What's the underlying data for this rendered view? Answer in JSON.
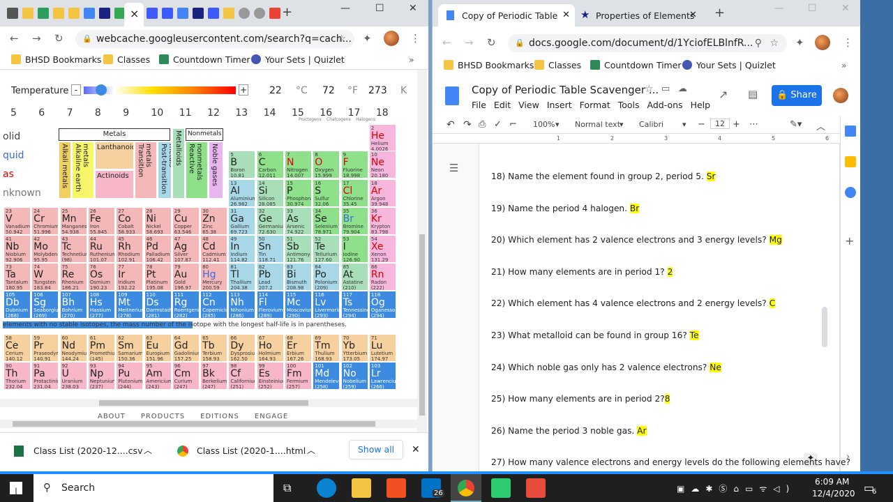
{
  "left": {
    "tabs_close": "×",
    "new_tab": "+",
    "url": "webcache.googleusercontent.com/search?q=cach...",
    "bookmarks": [
      {
        "label": "BHSD Bookmarks",
        "color": "#f4c542"
      },
      {
        "label": "Classes",
        "color": "#f4c542"
      },
      {
        "label": "Countdown Timer",
        "color": "#2e8b57"
      },
      {
        "label": "Your Sets | Quizlet",
        "color": "#4257b2"
      }
    ],
    "temperature": {
      "label": "Temperature",
      "minus": "-",
      "plus": "+",
      "celsius": "22",
      "c_unit": "°C",
      "fahrenheit": "72",
      "f_unit": "°F",
      "kelvin": "273",
      "k_unit": "K",
      "slider_fraction": 0.06
    },
    "group_numbers": [
      "5",
      "6",
      "7",
      "8",
      "9",
      "10",
      "11",
      "12",
      "13",
      "14",
      "15",
      "16",
      "17",
      "18"
    ],
    "group_subs": {
      "g15": "Pnictogens",
      "g16": "Chalcogens",
      "g17": "Halogens"
    },
    "states": [
      "olid",
      "quid",
      "as",
      "nknown"
    ],
    "categories": {
      "metals": "Metals",
      "nonmetals": "Nonmetals",
      "metalloids": "Metalloids",
      "alkali": "Alkali metals",
      "alkaline": "Alkaline earth metals",
      "lanthanoids": "Lanthanoids",
      "actinoids": "Actinoids",
      "transition": "Transition metals",
      "post_transition": "Post-transition metals",
      "reactive": "Reactive nonmetals",
      "noble": "Noble gases"
    },
    "note": "elements with no stable isotopes, the mass number of the isotope with the longest half-life is in parentheses.",
    "footer_links": [
      "ABOUT",
      "PRODUCTS",
      "EDITIONS",
      "ENGAGE"
    ]
  },
  "elements": [
    {
      "n": "2",
      "s": "He",
      "nm": "Helium",
      "m": "4.0026",
      "c": "#f7b7dc",
      "col": 18,
      "row": 1
    },
    {
      "n": "5",
      "s": "B",
      "nm": "Boron",
      "m": "10.81",
      "c": "#a8dfb8",
      "col": 13,
      "row": 2
    },
    {
      "n": "6",
      "s": "C",
      "nm": "Carbon",
      "m": "12.011",
      "c": "#8fe08a",
      "col": 14,
      "row": 2
    },
    {
      "n": "7",
      "s": "N",
      "nm": "Nitrogen",
      "m": "14.007",
      "c": "#8fe08a",
      "col": 15,
      "row": 2
    },
    {
      "n": "8",
      "s": "O",
      "nm": "Oxygen",
      "m": "15.999",
      "c": "#8fe08a",
      "col": 16,
      "row": 2
    },
    {
      "n": "9",
      "s": "F",
      "nm": "Fluorine",
      "m": "18.998",
      "c": "#8fe08a",
      "col": 17,
      "row": 2
    },
    {
      "n": "10",
      "s": "Ne",
      "nm": "Neon",
      "m": "20.180",
      "c": "#f7b7dc",
      "col": 18,
      "row": 2
    },
    {
      "n": "13",
      "s": "Al",
      "nm": "Aluminium",
      "m": "26.982",
      "c": "#a8d8e8",
      "col": 13,
      "row": 3
    },
    {
      "n": "14",
      "s": "Si",
      "nm": "Silicon",
      "m": "28.085",
      "c": "#a8dfb8",
      "col": 14,
      "row": 3
    },
    {
      "n": "15",
      "s": "P",
      "nm": "Phosphorus",
      "m": "30.974",
      "c": "#8fe08a",
      "col": 15,
      "row": 3
    },
    {
      "n": "16",
      "s": "S",
      "nm": "Sulfur",
      "m": "32.06",
      "c": "#8fe08a",
      "col": 16,
      "row": 3
    },
    {
      "n": "17",
      "s": "Cl",
      "nm": "Chlorine",
      "m": "35.45",
      "c": "#8fe08a",
      "col": 17,
      "row": 3
    },
    {
      "n": "18",
      "s": "Ar",
      "nm": "Argon",
      "m": "39.948",
      "c": "#f7b7dc",
      "col": 18,
      "row": 3
    },
    {
      "n": "23",
      "s": "V",
      "nm": "Vanadium",
      "m": "50.942",
      "c": "#f5b8b8",
      "col": 5,
      "row": 4
    },
    {
      "n": "24",
      "s": "Cr",
      "nm": "Chromium",
      "m": "51.996",
      "c": "#f5b8b8",
      "col": 6,
      "row": 4
    },
    {
      "n": "25",
      "s": "Mn",
      "nm": "Manganese",
      "m": "54.938",
      "c": "#f5b8b8",
      "col": 7,
      "row": 4
    },
    {
      "n": "26",
      "s": "Fe",
      "nm": "Iron",
      "m": "55.845",
      "c": "#f5b8b8",
      "col": 8,
      "row": 4
    },
    {
      "n": "27",
      "s": "Co",
      "nm": "Cobalt",
      "m": "58.933",
      "c": "#f5b8b8",
      "col": 9,
      "row": 4
    },
    {
      "n": "28",
      "s": "Ni",
      "nm": "Nickel",
      "m": "58.693",
      "c": "#f5b8b8",
      "col": 10,
      "row": 4
    },
    {
      "n": "29",
      "s": "Cu",
      "nm": "Copper",
      "m": "63.546",
      "c": "#f5b8b8",
      "col": 11,
      "row": 4
    },
    {
      "n": "30",
      "s": "Zn",
      "nm": "Zinc",
      "m": "65.38",
      "c": "#f5b8b8",
      "col": 12,
      "row": 4
    },
    {
      "n": "31",
      "s": "Ga",
      "nm": "Gallium",
      "m": "69.723",
      "c": "#a8d8e8",
      "col": 13,
      "row": 4
    },
    {
      "n": "32",
      "s": "Ge",
      "nm": "Germanium",
      "m": "72.630",
      "c": "#a8dfb8",
      "col": 14,
      "row": 4
    },
    {
      "n": "33",
      "s": "As",
      "nm": "Arsenic",
      "m": "74.922",
      "c": "#a8dfb8",
      "col": 15,
      "row": 4
    },
    {
      "n": "34",
      "s": "Se",
      "nm": "Selenium",
      "m": "78.971",
      "c": "#8fe08a",
      "col": 16,
      "row": 4
    },
    {
      "n": "35",
      "s": "Br",
      "nm": "Bromine",
      "m": "79.904",
      "c": "#8fe08a",
      "col": 17,
      "row": 4
    },
    {
      "n": "36",
      "s": "Kr",
      "nm": "Krypton",
      "m": "83.798",
      "c": "#f7b7dc",
      "col": 18,
      "row": 4
    },
    {
      "n": "41",
      "s": "Nb",
      "nm": "Niobium",
      "m": "92.906",
      "c": "#f5b8b8",
      "col": 5,
      "row": 5
    },
    {
      "n": "42",
      "s": "Mo",
      "nm": "Molybdenum",
      "m": "95.95",
      "c": "#f5b8b8",
      "col": 6,
      "row": 5
    },
    {
      "n": "43",
      "s": "Tc",
      "nm": "Technetium",
      "m": "(98)",
      "c": "#f5b8b8",
      "col": 7,
      "row": 5
    },
    {
      "n": "44",
      "s": "Ru",
      "nm": "Ruthenium",
      "m": "101.07",
      "c": "#f5b8b8",
      "col": 8,
      "row": 5
    },
    {
      "n": "45",
      "s": "Rh",
      "nm": "Rhodium",
      "m": "102.91",
      "c": "#f5b8b8",
      "col": 9,
      "row": 5
    },
    {
      "n": "46",
      "s": "Pd",
      "nm": "Palladium",
      "m": "106.42",
      "c": "#f5b8b8",
      "col": 10,
      "row": 5
    },
    {
      "n": "47",
      "s": "Ag",
      "nm": "Silver",
      "m": "107.87",
      "c": "#f5b8b8",
      "col": 11,
      "row": 5
    },
    {
      "n": "48",
      "s": "Cd",
      "nm": "Cadmium",
      "m": "112.41",
      "c": "#f5b8b8",
      "col": 12,
      "row": 5
    },
    {
      "n": "49",
      "s": "In",
      "nm": "Indium",
      "m": "114.82",
      "c": "#a8d8e8",
      "col": 13,
      "row": 5
    },
    {
      "n": "50",
      "s": "Sn",
      "nm": "Tin",
      "m": "118.71",
      "c": "#a8d8e8",
      "col": 14,
      "row": 5
    },
    {
      "n": "51",
      "s": "Sb",
      "nm": "Antimony",
      "m": "121.76",
      "c": "#a8dfb8",
      "col": 15,
      "row": 5
    },
    {
      "n": "52",
      "s": "Te",
      "nm": "Tellurium",
      "m": "127.60",
      "c": "#a8dfb8",
      "col": 16,
      "row": 5
    },
    {
      "n": "53",
      "s": "I",
      "nm": "Iodine",
      "m": "126.90",
      "c": "#8fe08a",
      "col": 17,
      "row": 5
    },
    {
      "n": "54",
      "s": "Xe",
      "nm": "Xenon",
      "m": "131.29",
      "c": "#f7b7dc",
      "col": 18,
      "row": 5
    },
    {
      "n": "73",
      "s": "Ta",
      "nm": "Tantalum",
      "m": "180.95",
      "c": "#f5b8b8",
      "col": 5,
      "row": 6
    },
    {
      "n": "74",
      "s": "W",
      "nm": "Tungsten",
      "m": "183.84",
      "c": "#f5b8b8",
      "col": 6,
      "row": 6
    },
    {
      "n": "75",
      "s": "Re",
      "nm": "Rhenium",
      "m": "186.21",
      "c": "#f5b8b8",
      "col": 7,
      "row": 6
    },
    {
      "n": "76",
      "s": "Os",
      "nm": "Osmium",
      "m": "190.23",
      "c": "#f5b8b8",
      "col": 8,
      "row": 6
    },
    {
      "n": "77",
      "s": "Ir",
      "nm": "Iridium",
      "m": "192.22",
      "c": "#f5b8b8",
      "col": 9,
      "row": 6
    },
    {
      "n": "78",
      "s": "Pt",
      "nm": "Platinum",
      "m": "195.08",
      "c": "#f5b8b8",
      "col": 10,
      "row": 6
    },
    {
      "n": "79",
      "s": "Au",
      "nm": "Gold",
      "m": "196.97",
      "c": "#f5b8b8",
      "col": 11,
      "row": 6
    },
    {
      "n": "80",
      "s": "Hg",
      "nm": "Mercury",
      "m": "200.59",
      "c": "#f5b8b8",
      "col": 12,
      "row": 6
    },
    {
      "n": "81",
      "s": "Tl",
      "nm": "Thallium",
      "m": "204.38",
      "c": "#a8d8e8",
      "col": 13,
      "row": 6
    },
    {
      "n": "82",
      "s": "Pb",
      "nm": "Lead",
      "m": "207.2",
      "c": "#a8d8e8",
      "col": 14,
      "row": 6
    },
    {
      "n": "83",
      "s": "Bi",
      "nm": "Bismuth",
      "m": "208.98",
      "c": "#a8d8e8",
      "col": 15,
      "row": 6
    },
    {
      "n": "84",
      "s": "Po",
      "nm": "Polonium",
      "m": "(209)",
      "c": "#a8d8e8",
      "col": 16,
      "row": 6
    },
    {
      "n": "85",
      "s": "At",
      "nm": "Astatine",
      "m": "(210)",
      "c": "#a8dfb8",
      "col": 17,
      "row": 6
    },
    {
      "n": "86",
      "s": "Rn",
      "nm": "Radon",
      "m": "(222)",
      "c": "#f7b7dc",
      "col": 18,
      "row": 6
    },
    {
      "n": "105",
      "s": "Db",
      "nm": "Dubnium",
      "m": "(268)",
      "c": "#3d8be0",
      "col": 5,
      "row": 7
    },
    {
      "n": "106",
      "s": "Sg",
      "nm": "Seaborgium",
      "m": "(269)",
      "c": "#3d8be0",
      "col": 6,
      "row": 7
    },
    {
      "n": "107",
      "s": "Bh",
      "nm": "Bohrium",
      "m": "(270)",
      "c": "#3d8be0",
      "col": 7,
      "row": 7
    },
    {
      "n": "108",
      "s": "Hs",
      "nm": "Hassium",
      "m": "(277)",
      "c": "#3d8be0",
      "col": 8,
      "row": 7
    },
    {
      "n": "109",
      "s": "Mt",
      "nm": "Meitnerium",
      "m": "(278)",
      "c": "#3d8be0",
      "col": 9,
      "row": 7
    },
    {
      "n": "110",
      "s": "Ds",
      "nm": "Darmstadtium",
      "m": "(281)",
      "c": "#3d8be0",
      "col": 10,
      "row": 7
    },
    {
      "n": "111",
      "s": "Rg",
      "nm": "Roentgenium",
      "m": "(282)",
      "c": "#3d8be0",
      "col": 11,
      "row": 7
    },
    {
      "n": "112",
      "s": "Cn",
      "nm": "Copernicium",
      "m": "(285)",
      "c": "#3d8be0",
      "col": 12,
      "row": 7
    },
    {
      "n": "113",
      "s": "Nh",
      "nm": "Nihonium",
      "m": "(286)",
      "c": "#3d8be0",
      "col": 13,
      "row": 7
    },
    {
      "n": "114",
      "s": "Fl",
      "nm": "Flerovium",
      "m": "(289)",
      "c": "#3d8be0",
      "col": 14,
      "row": 7
    },
    {
      "n": "115",
      "s": "Mc",
      "nm": "Moscovium",
      "m": "(290)",
      "c": "#3d8be0",
      "col": 15,
      "row": 7
    },
    {
      "n": "116",
      "s": "Lv",
      "nm": "Livermorium",
      "m": "(293)",
      "c": "#3d8be0",
      "col": 16,
      "row": 7
    },
    {
      "n": "117",
      "s": "Ts",
      "nm": "Tennessine",
      "m": "(294)",
      "c": "#3d8be0",
      "col": 17,
      "row": 7
    },
    {
      "n": "118",
      "s": "Og",
      "nm": "Oganesson",
      "m": "(294)",
      "c": "#3d8be0",
      "col": 18,
      "row": 7
    },
    {
      "n": "58",
      "s": "Ce",
      "nm": "Cerium",
      "m": "140.12",
      "c": "#f7d0a0",
      "col": 5,
      "row": 9
    },
    {
      "n": "59",
      "s": "Pr",
      "nm": "Praseodymium",
      "m": "140.91",
      "c": "#f7d0a0",
      "col": 6,
      "row": 9
    },
    {
      "n": "60",
      "s": "Nd",
      "nm": "Neodymium",
      "m": "144.24",
      "c": "#f7d0a0",
      "col": 7,
      "row": 9
    },
    {
      "n": "61",
      "s": "Pm",
      "nm": "Promethium",
      "m": "(145)",
      "c": "#f7d0a0",
      "col": 8,
      "row": 9
    },
    {
      "n": "62",
      "s": "Sm",
      "nm": "Samarium",
      "m": "150.36",
      "c": "#f7d0a0",
      "col": 9,
      "row": 9
    },
    {
      "n": "63",
      "s": "Eu",
      "nm": "Europium",
      "m": "151.96",
      "c": "#f7d0a0",
      "col": 10,
      "row": 9
    },
    {
      "n": "64",
      "s": "Gd",
      "nm": "Gadolinium",
      "m": "157.25",
      "c": "#f7d0a0",
      "col": 11,
      "row": 9
    },
    {
      "n": "65",
      "s": "Tb",
      "nm": "Terbium",
      "m": "158.93",
      "c": "#f7d0a0",
      "col": 12,
      "row": 9
    },
    {
      "n": "66",
      "s": "Dy",
      "nm": "Dysprosium",
      "m": "162.50",
      "c": "#f7d0a0",
      "col": 13,
      "row": 9
    },
    {
      "n": "67",
      "s": "Ho",
      "nm": "Holmium",
      "m": "164.93",
      "c": "#f7d0a0",
      "col": 14,
      "row": 9
    },
    {
      "n": "68",
      "s": "Er",
      "nm": "Erbium",
      "m": "167.26",
      "c": "#f7d0a0",
      "col": 15,
      "row": 9
    },
    {
      "n": "69",
      "s": "Tm",
      "nm": "Thulium",
      "m": "168.93",
      "c": "#f7d0a0",
      "col": 16,
      "row": 9
    },
    {
      "n": "70",
      "s": "Yb",
      "nm": "Ytterbium",
      "m": "173.05",
      "c": "#f7d0a0",
      "col": 17,
      "row": 9
    },
    {
      "n": "71",
      "s": "Lu",
      "nm": "Lutetium",
      "m": "174.97",
      "c": "#f7d0a0",
      "col": 18,
      "row": 9
    },
    {
      "n": "90",
      "s": "Th",
      "nm": "Thorium",
      "m": "232.04",
      "c": "#f7b7c8",
      "col": 5,
      "row": 10
    },
    {
      "n": "91",
      "s": "Pa",
      "nm": "Protactinium",
      "m": "231.04",
      "c": "#f7b7c8",
      "col": 6,
      "row": 10
    },
    {
      "n": "92",
      "s": "U",
      "nm": "Uranium",
      "m": "238.03",
      "c": "#f7b7c8",
      "col": 7,
      "row": 10
    },
    {
      "n": "93",
      "s": "Np",
      "nm": "Neptunium",
      "m": "(237)",
      "c": "#f7b7c8",
      "col": 8,
      "row": 10
    },
    {
      "n": "94",
      "s": "Pu",
      "nm": "Plutonium",
      "m": "(244)",
      "c": "#f7b7c8",
      "col": 9,
      "row": 10
    },
    {
      "n": "95",
      "s": "Am",
      "nm": "Americium",
      "m": "(243)",
      "c": "#f7b7c8",
      "col": 10,
      "row": 10
    },
    {
      "n": "96",
      "s": "Cm",
      "nm": "Curium",
      "m": "(247)",
      "c": "#f7b7c8",
      "col": 11,
      "row": 10
    },
    {
      "n": "97",
      "s": "Bk",
      "nm": "Berkelium",
      "m": "(247)",
      "c": "#f7b7c8",
      "col": 12,
      "row": 10
    },
    {
      "n": "98",
      "s": "Cf",
      "nm": "Californium",
      "m": "(251)",
      "c": "#f7b7c8",
      "col": 13,
      "row": 10
    },
    {
      "n": "99",
      "s": "Es",
      "nm": "Einsteinium",
      "m": "(252)",
      "c": "#f7b7c8",
      "col": 14,
      "row": 10
    },
    {
      "n": "100",
      "s": "Fm",
      "nm": "Fermium",
      "m": "(257)",
      "c": "#f7b7c8",
      "col": 15,
      "row": 10
    },
    {
      "n": "101",
      "s": "Md",
      "nm": "Mendelevium",
      "m": "(258)",
      "c": "#3d8be0",
      "col": 16,
      "row": 10
    },
    {
      "n": "102",
      "s": "No",
      "nm": "Nobelium",
      "m": "(259)",
      "c": "#3d8be0",
      "col": 17,
      "row": 10
    },
    {
      "n": "103",
      "s": "Lr",
      "nm": "Lawrencium",
      "m": "(266)",
      "c": "#3d8be0",
      "col": 18,
      "row": 10
    }
  ],
  "downloads": {
    "items": [
      "Class List (2020-12....csv",
      "Class List (2020-1....html"
    ],
    "show_all": "Show all"
  },
  "right": {
    "tabs": [
      "Copy of Periodic Table S",
      "Properties of Elements"
    ],
    "url": "docs.google.com/document/d/1YciofELBlnfR...",
    "bookmarks": [
      "BHSD Bookmarks",
      "Classes",
      "Countdown Timer",
      "Your Sets | Quizlet"
    ],
    "doc_title": "Copy of Periodic Table Scavenger ...",
    "menu": [
      "File",
      "Edit",
      "View",
      "Insert",
      "Format",
      "Tools",
      "Add-ons",
      "Help"
    ],
    "share": "Share",
    "toolbar": {
      "zoom": "100%",
      "style": "Normal text",
      "font": "Calibri",
      "size": "12",
      "minus": "−",
      "plus": "+"
    },
    "ruler": [
      "1",
      "2",
      "3",
      "4",
      "5",
      "6"
    ],
    "questions": [
      {
        "q": "18) Name the element found in group 2, period 5. ",
        "a": "Sr"
      },
      {
        "q": "19) Name the period 4 halogen. ",
        "a": "Br"
      },
      {
        "q": "20) Which element has 2 valence electrons and 3 energy levels? ",
        "a": "Mg"
      },
      {
        "q": "21) How many elements are in period 1? ",
        "a": "2"
      },
      {
        "q": "22) Which element has 4 valence electrons and 2 energy levels? ",
        "a": "C"
      },
      {
        "q": "23) What metalloid can be found in group 16? ",
        "a": "Te"
      },
      {
        "q": "24) Which noble gas only has 2 valence electrons? ",
        "a": "Ne"
      },
      {
        "q": "25) How many elements are in period 2?",
        "a": "8"
      },
      {
        "q": "26) Name the period 3 noble gas. ",
        "a": "Ar"
      },
      {
        "q": "27) How many valence electrons and energy levels do the following elements have?",
        "a": ""
      }
    ]
  },
  "taskbar": {
    "search": "Search",
    "time": "6:09 AM",
    "date": "12/4/2020",
    "mail_badge": "26",
    "notif_badge": "6"
  }
}
